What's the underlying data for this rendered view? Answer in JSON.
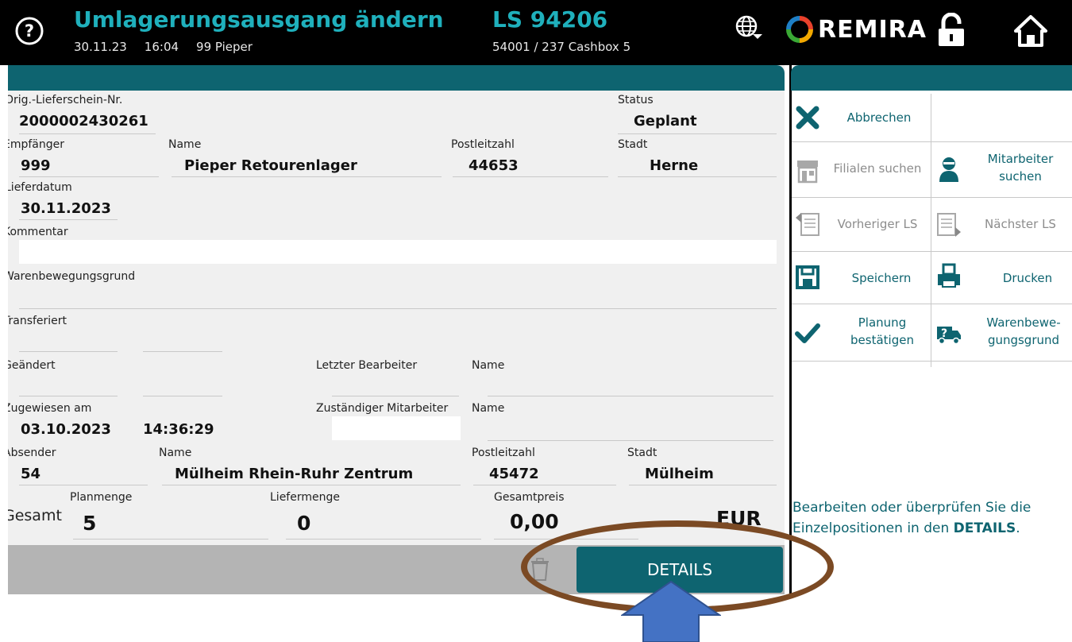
{
  "header": {
    "title": "Umlagerungsausgang ändern",
    "date": "30.11.23",
    "time": "16:04",
    "user": "99 Pieper",
    "ls_number": "LS 94206",
    "ls_sub": "54001 / 237 Cashbox 5",
    "brand": "REMIRA"
  },
  "form": {
    "orig_ls_label": "Orig.-Lieferschein-Nr.",
    "orig_ls_value": "2000002430261",
    "status_label": "Status",
    "status_value": "Geplant",
    "recipient_label": "Empfänger",
    "recipient_value": "999",
    "name_label": "Name",
    "recipient_name": "Pieper Retourenlager",
    "plz_label": "Postleitzahl",
    "recipient_plz": "44653",
    "city_label": "Stadt",
    "recipient_city": "Herne",
    "delivery_date_label": "Lieferdatum",
    "delivery_date_value": "30.11.2023",
    "comment_label": "Kommentar",
    "comment_value": "",
    "reason_label": "Warenbewegungsgrund",
    "transferred_label": "Transferiert",
    "changed_label": "Geändert",
    "last_editor_label": "Letzter Bearbeiter",
    "assigned_label": "Zugewiesen am",
    "assigned_date": "03.10.2023",
    "assigned_time": "14:36:29",
    "responsible_label": "Zuständiger Mitarbeiter",
    "sender_label": "Absender",
    "sender_value": "54",
    "sender_name": "Mülheim Rhein-Ruhr Zentrum",
    "sender_plz": "45472",
    "sender_city": "Mülheim",
    "total_label": "Gesamt",
    "planned_qty_label": "Planmenge",
    "planned_qty": "5",
    "delivered_qty_label": "Liefermenge",
    "delivered_qty": "0",
    "total_price_label": "Gesamtpreis",
    "total_price": "0,00",
    "currency": "EUR",
    "details_label": "DETAILS"
  },
  "actions": {
    "cancel": "Abbrechen",
    "find_branches": "Filialen suchen",
    "find_employee": "Mitarbeiter suchen",
    "prev_ls": "Vorheriger LS",
    "next_ls": "Nächster LS",
    "save": "Speichern",
    "print": "Drucken",
    "confirm_planning": "Planung bestätigen",
    "goods_movement_reason": "Warenbewe-gungsgrund",
    "hint_text": "Bearbeiten oder überprüfen Sie die Einzelpositionen in den",
    "hint_bold": "DETAILS",
    "hint_end": "."
  },
  "colors": {
    "teal_dark": "#0e6470",
    "teal_light": "#1fb0bc",
    "annotation_ellipse": "#7b4a24",
    "annotation_arrow": "#4472c4"
  },
  "icons": [
    "help-icon",
    "globe-icon",
    "remira-logo",
    "lock-icon",
    "home-icon",
    "close-icon",
    "store-icon",
    "employee-icon",
    "prev-doc-icon",
    "next-doc-icon",
    "save-icon",
    "print-icon",
    "check-icon",
    "truck-icon",
    "trash-icon"
  ]
}
